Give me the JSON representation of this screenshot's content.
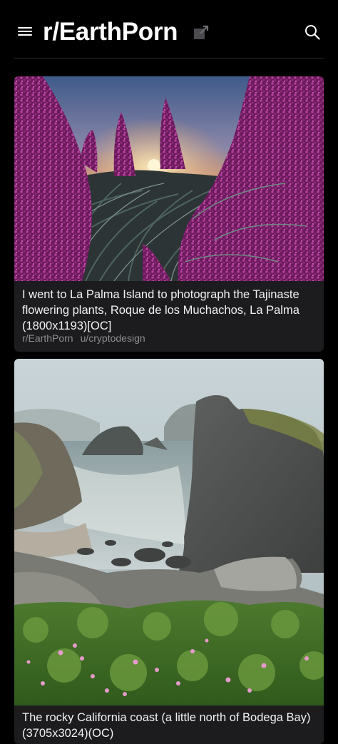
{
  "header": {
    "title": "r/EarthPorn",
    "menu_icon": "hamburger-menu-icon",
    "external_icon": "open-external-icon",
    "search_icon": "search-icon"
  },
  "posts": [
    {
      "title": "I went to La Palma Island to photograph the Tajinaste flowering plants, Roque de los Muchachos, La Palma (1800x1193)[OC]",
      "subreddit": "r/EarthPorn",
      "author": "u/cryptodesign",
      "image": "tajinaste-sunset-photo"
    },
    {
      "title": "The rocky California coast (a little north of Bodega Bay) (3705x3024)(OC)",
      "image": "rocky-coast-photo"
    }
  ]
}
